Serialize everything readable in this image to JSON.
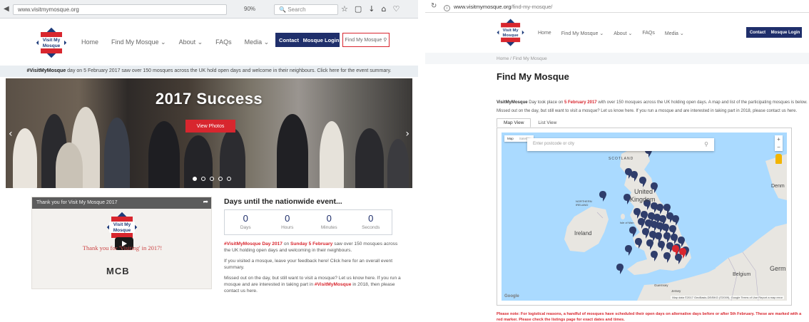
{
  "left": {
    "browser": {
      "url": "www.visitmymosque.org",
      "zoom": "90%",
      "search_placeholder": "Search"
    },
    "header": {
      "logo_line1": "Visit My",
      "logo_line2": "Mosque",
      "nav": [
        "Home",
        "Find My Mosque ⌄",
        "About ⌄",
        "FAQs",
        "Media ⌄"
      ],
      "contact_label": "Contact",
      "login_label": "Mosque Login",
      "find_label": "Find My Mosque"
    },
    "notice": {
      "brand": "#VisitMyMosque",
      "text": " day on 5 February 2017 saw over 150 mosques across the UK hold open days and welcome in their neighbours. Click here for the event summary."
    },
    "hero": {
      "title": "2017 Success",
      "button": "View Photos"
    },
    "video": {
      "title": "Thank you for Visit My Mosque 2017",
      "logo_line1": "Visit My",
      "logo_line2": "Mosque",
      "thanks": "Thank you for 'Visiting' in 2017!",
      "mcb": "MCB"
    },
    "countdown": {
      "title": "Days until the nationwide event...",
      "units": [
        {
          "value": "0",
          "label": "Days"
        },
        {
          "value": "0",
          "label": "Hours"
        },
        {
          "value": "0",
          "label": "Minutes"
        },
        {
          "value": "0",
          "label": "Seconds"
        }
      ]
    },
    "paragraphs": {
      "p1_brand": "#VisitMyMosque Day 2017",
      "p1_a": " on ",
      "p1_day": "Sunday 5 February",
      "p1_b": " saw over 150 mosques across the UK holding open days and welcoming in their neighbours.",
      "p2": "If you visited a mosque, leave your feedback here! Click here for an overall event summary.",
      "p3_a": "Missed out on the day, but still want to visit a mosque? Let us know here. If you run a mosque and are interested in taking part in ",
      "p3_brand": "#VisitMyMosque",
      "p3_b": " in 2018, then please contact us here."
    }
  },
  "right": {
    "browser": {
      "url_host": "www.visitmymosque.org",
      "url_path": "/find-my-mosque/"
    },
    "header": {
      "logo_line1": "Visit My",
      "logo_line2": "Mosque",
      "nav": [
        "Home",
        "Find My Mosque ⌄",
        "About ⌄",
        "FAQs",
        "Media ⌄"
      ],
      "contact_label": "Contact",
      "login_label": "Mosque Login"
    },
    "breadcrumb": "Home  /  Find My Mosque",
    "title": "Find My Mosque",
    "intro": {
      "brand": "VisitMyMosque",
      "a": " Day took place on ",
      "date": "5 February 2017",
      "b": " with over 150 mosques across the UK holding open days. A map and list of the participating mosques is below.",
      "line2": "Missed out on the day, but still want to visit a mosque? Let us know here. If you run a mosque and are interested in taking part in 2018, please contact us here."
    },
    "tabs": [
      "Map View",
      "List View"
    ],
    "map": {
      "type_map": "Map",
      "type_sat": "Satellite",
      "search_placeholder": "Enter postcode or city",
      "labels": {
        "scotland": "SCOTLAND",
        "uk1": "United",
        "uk2": "Kingdom",
        "ireland": "Ireland",
        "northern_ireland": "NORTHERN IRELAND",
        "isle": "Isle of Man",
        "denmark": "Denm",
        "belgium": "Belgium",
        "germany": "Germ",
        "guernsey": "Guernsey",
        "jersey": "Jersey",
        "google": "Google",
        "footer": "Map data ©2017 GeoBasis-DE/BKG (©2009), Google  Terms of Use  Report a map error"
      },
      "colors": {
        "water": "#aadaff",
        "land": "#e8e6e1",
        "pin_blue": "#2f3d6b",
        "pin_red": "#d8262e"
      }
    },
    "note_a": "Please note: For logistical reasons, a handful of mosques have scheduled their open days on alternative days before or after 5th February. These are marked with a red",
    "note_b": "marker. Please check the listings page for exact dates and times."
  },
  "colors": {
    "navy": "#1f2f6b",
    "red": "#d8262e",
    "logo_blue": "#1d3b7a"
  }
}
